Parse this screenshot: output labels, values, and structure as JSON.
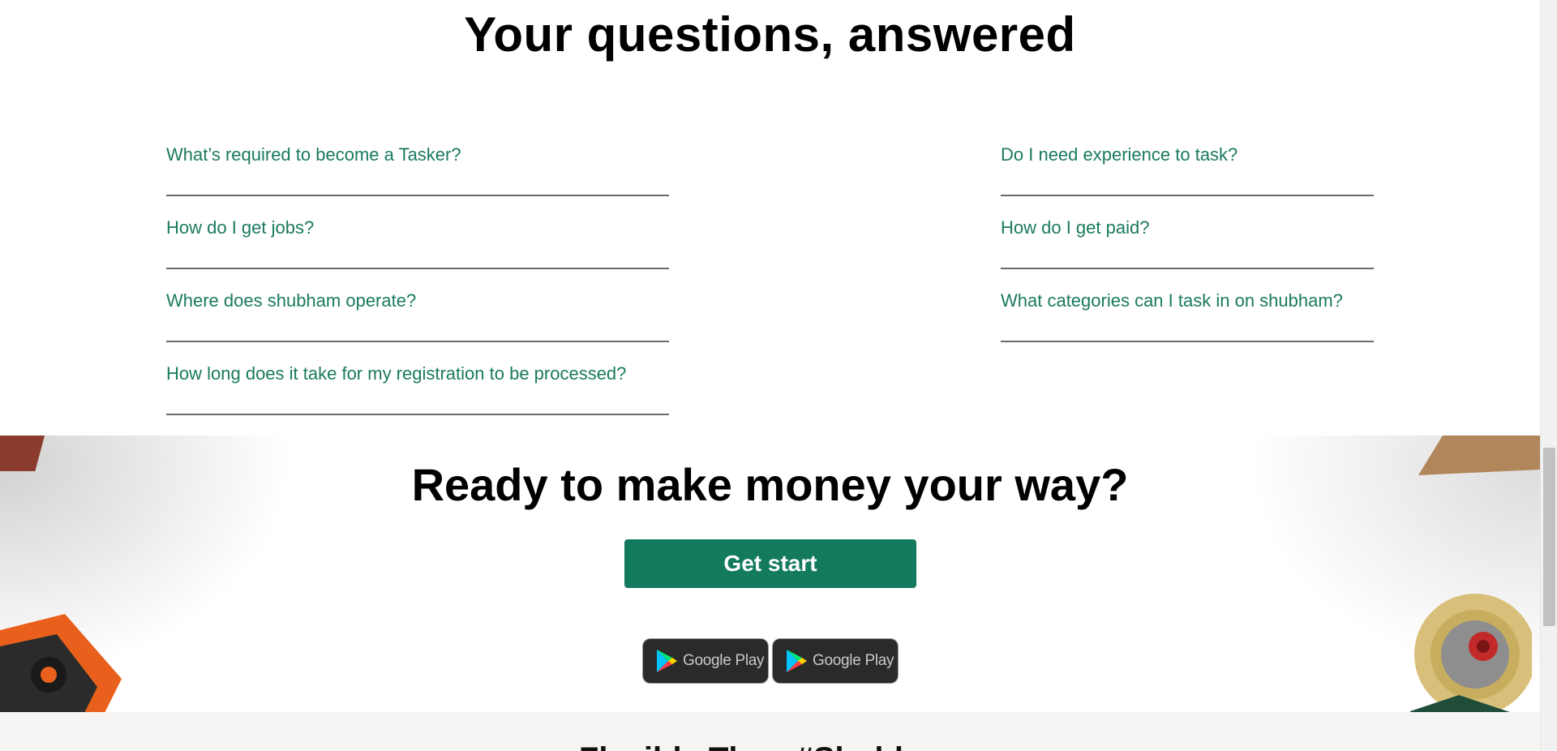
{
  "faq": {
    "title": "Your questions, answered",
    "left_questions": [
      "What’s required to become a Tasker?",
      "How do I get jobs?",
      "Where does shubham operate?",
      "How long does it take for my registration to be processed?"
    ],
    "right_questions": [
      "Do I need experience to task?",
      "How do I get paid?",
      "What categories can I task in on shubham?"
    ]
  },
  "cta": {
    "title": "Ready to make money your way?",
    "button_label": "Get start",
    "store_badges": [
      {
        "label": "Google Play",
        "icon": "google-play-icon"
      },
      {
        "label": "Google Play",
        "icon": "google-play-icon"
      }
    ]
  },
  "footer": {
    "heading_partial": "Flexibly Then #Shubham"
  },
  "colors": {
    "accent": "#137a5e",
    "link": "#1a7a5f",
    "divider": "#6b6b6b"
  }
}
